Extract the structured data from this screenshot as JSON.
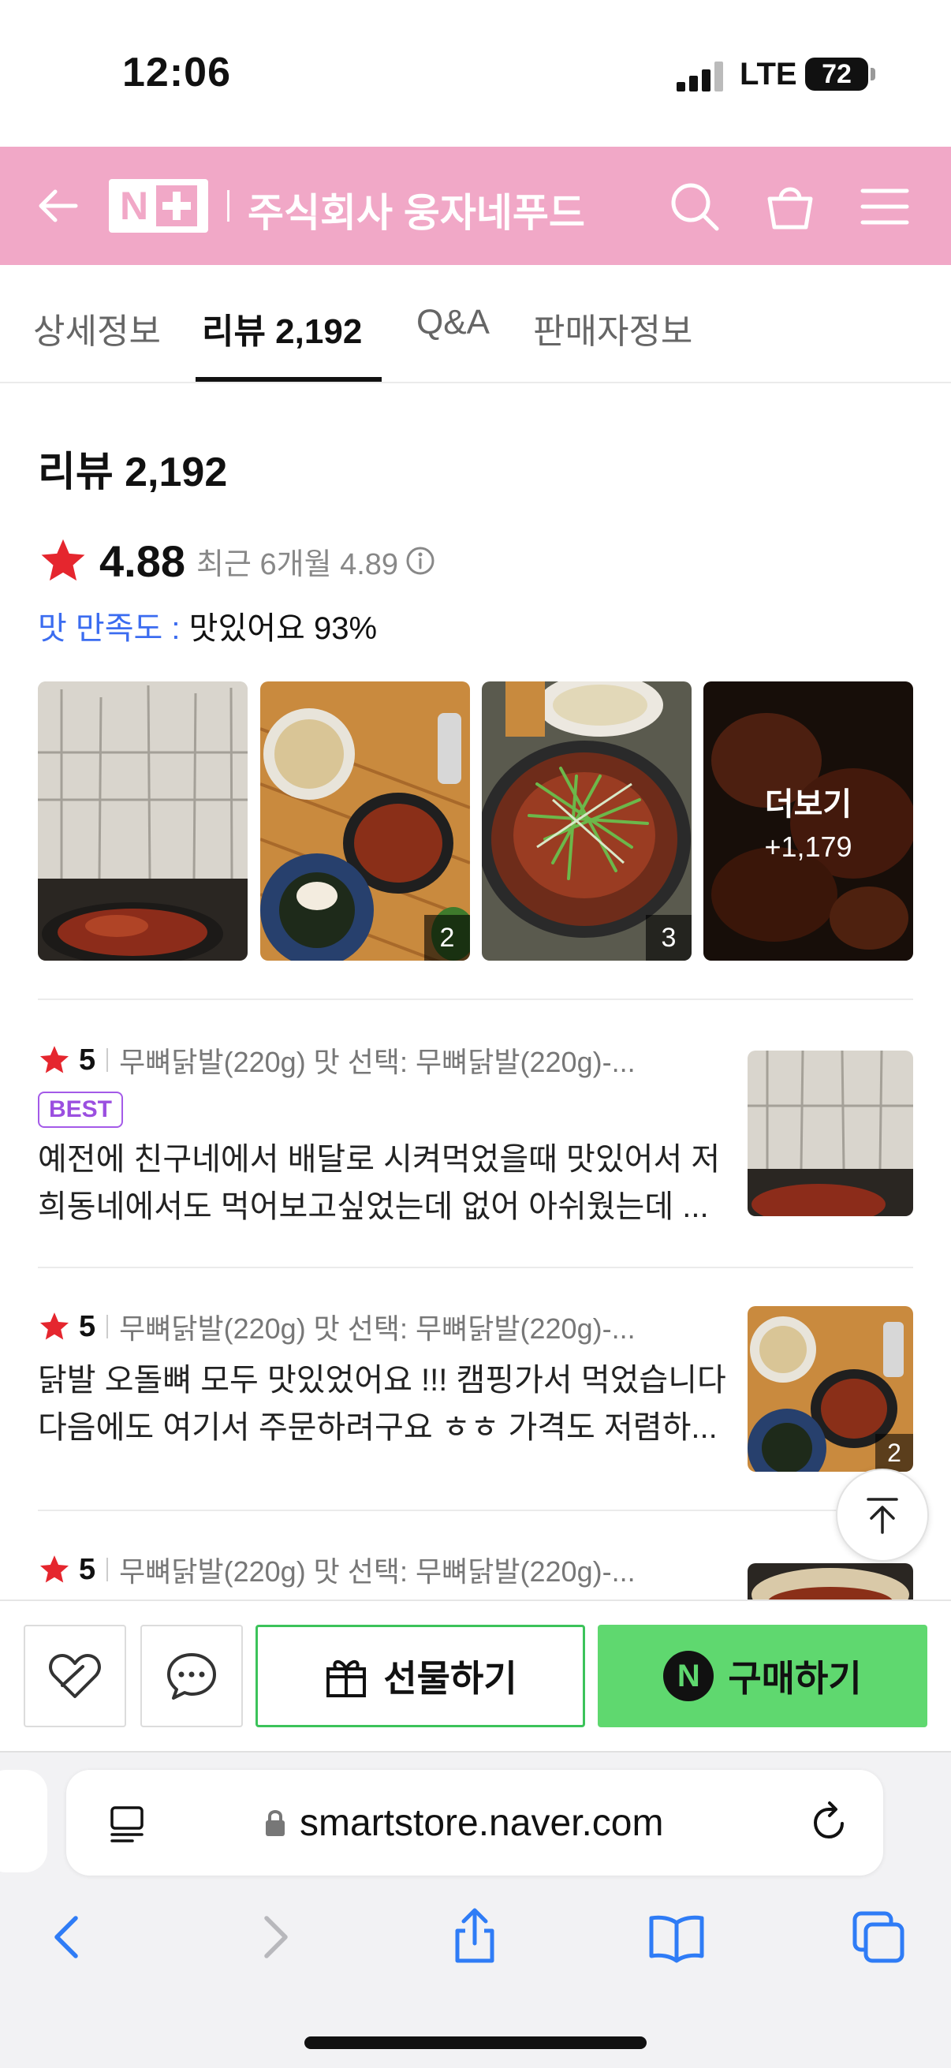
{
  "status": {
    "time": "12:06",
    "network": "LTE",
    "battery": "72"
  },
  "header": {
    "logo_n": "N",
    "store_name": "주식회사 웅자네푸드"
  },
  "tabs": [
    {
      "label": "상세정보"
    },
    {
      "label": "리뷰 2,192"
    },
    {
      "label": "Q&A"
    },
    {
      "label": "판매자정보"
    }
  ],
  "review_summary": {
    "heading": "리뷰 2,192",
    "rating": "4.88",
    "recent": "최근 6개월 4.89",
    "taste_label": "맛 만족도 : ",
    "taste_value": "맛있어요 93%"
  },
  "photos": {
    "counts": [
      "2",
      "3"
    ],
    "more_label": "더보기",
    "more_count": "+1,179"
  },
  "reviews": [
    {
      "score": "5",
      "option": "무뼈닭발(220g) 맛 선택: 무뼈닭발(220g)-...",
      "badge": "BEST",
      "line1": "예전에 친구네에서 배달로 시켜먹었을때 맛있어서 저",
      "line2": "희동네에서도 먹어보고싶었는데 없어 아쉬웠는데 ...",
      "thumb_count": ""
    },
    {
      "score": "5",
      "option": "무뼈닭발(220g) 맛 선택: 무뼈닭발(220g)-...",
      "line1": "닭발 오돌뼈 모두 맛있었어요 !!! 캠핑가서 먹었습니다",
      "line2": "다음에도 여기서 주문하려구요 ㅎㅎ 가격도 저렴하...",
      "thumb_count": "2"
    },
    {
      "score": "5",
      "option": "무뼈닭발(220g) 맛 선택: 무뼈닭발(220g)-..."
    }
  ],
  "actions": {
    "gift_label": "선물하기",
    "buy_label": "구매하기",
    "npay": "N"
  },
  "browser": {
    "url": "smartstore.naver.com"
  }
}
